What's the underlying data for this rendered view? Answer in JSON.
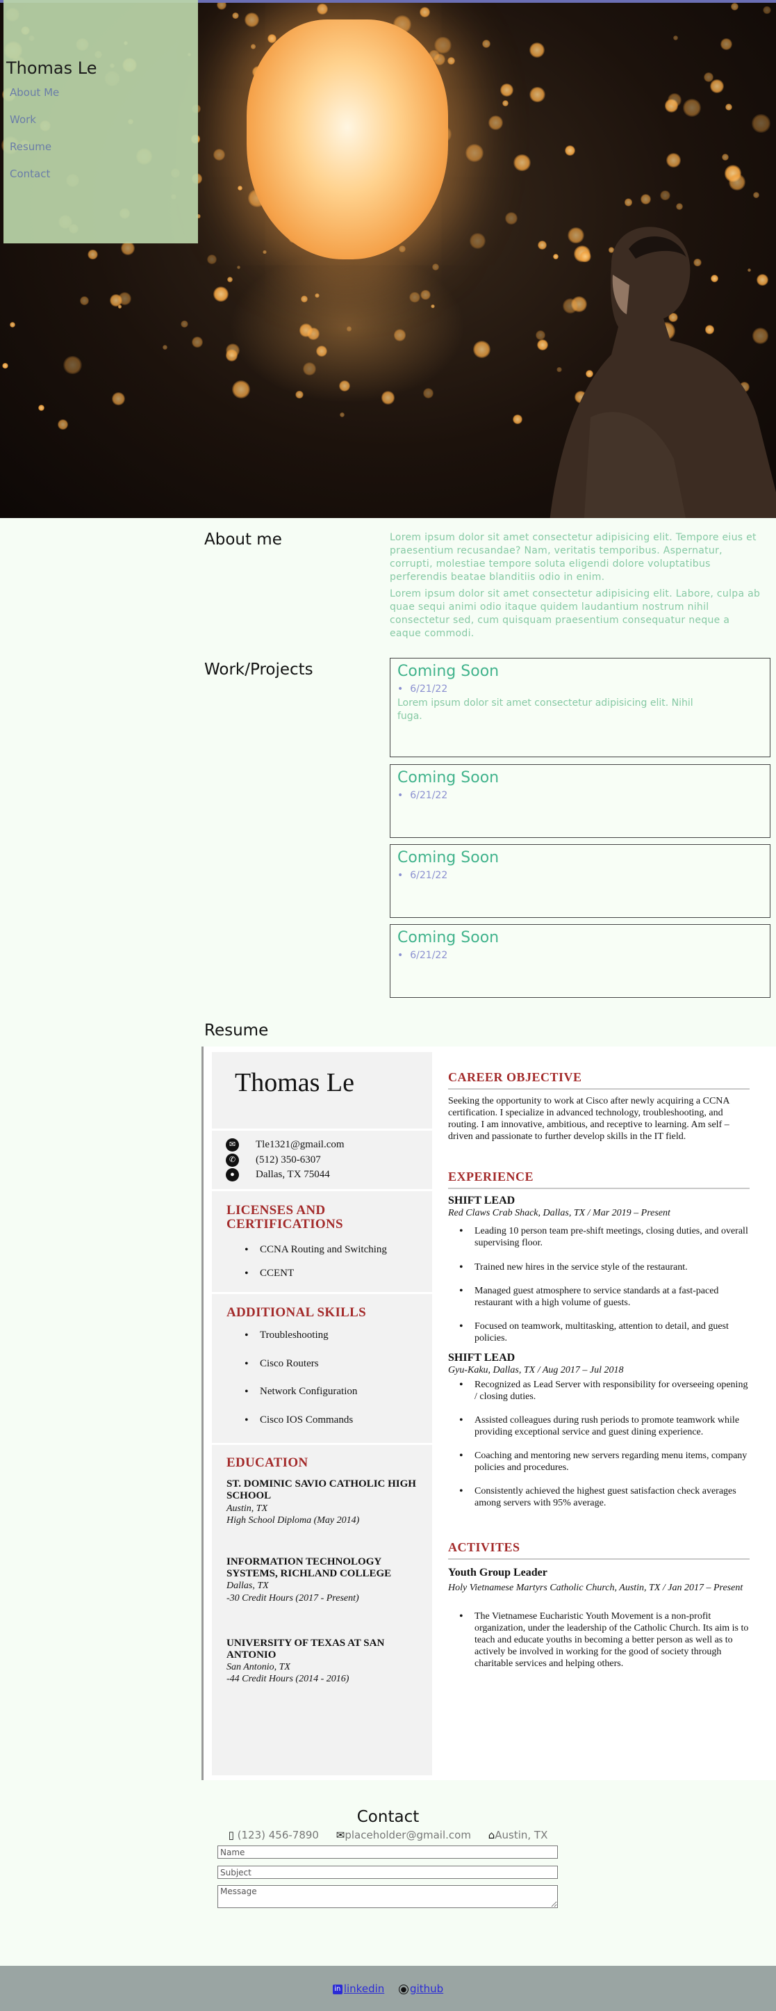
{
  "nav": {
    "brand": "Thomas Le",
    "links": [
      "About Me",
      "Work",
      "Resume",
      "Contact"
    ]
  },
  "about": {
    "title": "About me",
    "p1": "Lorem ipsum dolor sit amet consectetur adipisicing elit. Tempore eius et praesentium recusandae? Nam, veritatis temporibus. Aspernatur, corrupti, molestiae tempore soluta eligendi dolore voluptatibus perferendis beatae blanditiis odio in enim.",
    "p2": "Lorem ipsum dolor sit amet consectetur adipisicing elit. Labore, culpa ab quae sequi animi odio itaque quidem laudantium nostrum nihil consectetur sed, cum quisquam praesentium consequatur neque a eaque commodi."
  },
  "work": {
    "title": "Work/Projects",
    "cards": [
      {
        "title": "Coming Soon",
        "date": "6/21/22",
        "text": "Lorem ipsum dolor sit amet consectetur adipisicing elit. Nihil fuga."
      },
      {
        "title": "Coming Soon",
        "date": "6/21/22"
      },
      {
        "title": "Coming Soon",
        "date": "6/21/22"
      },
      {
        "title": "Coming Soon",
        "date": "6/21/22"
      }
    ]
  },
  "resume": {
    "title": "Resume",
    "name": "Thomas Le",
    "contact": {
      "email": "Tle1321@gmail.com",
      "phone": "(512) 350-6307",
      "location": "Dallas, TX 75044"
    },
    "licenses": {
      "heading_1": "LICENSES AND",
      "heading_2": "CERTIFICATIONS",
      "items": [
        "CCNA Routing and Switching",
        "CCENT"
      ]
    },
    "skills": {
      "heading": "ADDITIONAL SKILLS",
      "items": [
        "Troubleshooting",
        "Cisco Routers",
        "Network Configuration",
        "Cisco IOS Commands"
      ]
    },
    "education": {
      "heading": "EDUCATION",
      "schools": [
        {
          "name": "ST. DOMINIC SAVIO CATHOLIC HIGH SCHOOL",
          "location": "Austin, TX",
          "detail": "High School Diploma (May 2014)"
        },
        {
          "name": "INFORMATION TECHNOLOGY SYSTEMS, RICHLAND COLLEGE",
          "location": " Dallas, TX",
          "detail": "-30 Credit Hours (2017 - Present)"
        },
        {
          "name": "UNIVERSITY OF TEXAS AT SAN ANTONIO",
          "location": "San Antonio, TX",
          "detail": "-44 Credit Hours (2014 - 2016)"
        }
      ]
    },
    "objective": {
      "heading": "CAREER OBJECTIVE",
      "text": "Seeking the opportunity to work at Cisco after newly acquiring a CCNA certification. I specialize in advanced technology, troubleshooting, and routing. I am innovative, ambitious, and receptive to learning. Am self – driven and passionate  to further develop skills in the IT field."
    },
    "experience": {
      "heading": "EXPERIENCE",
      "jobs": [
        {
          "title": "SHIFT LEAD",
          "place": "Red Claws Crab Shack, Dallas, TX / Mar 2019 – Present",
          "bullets": [
            "Leading 10 person team pre-shift meetings, closing duties, and overall supervising floor.",
            "Trained new hires in the service style of the restaurant.",
            "Managed guest atmosphere to service standards at a fast-paced restaurant with a high volume of guests.",
            "Focused on teamwork, multitasking, attention to detail, and guest policies."
          ]
        },
        {
          "title": "SHIFT LEAD",
          "place": "Gyu-Kaku, Dallas, TX / Aug 2017 – Jul 2018",
          "bullets": [
            "Recognized as Lead Server with responsibility for overseeing opening / closing duties.",
            "Assisted colleagues during rush periods to promote teamwork while providing exceptional service and guest dining experience.",
            "Coaching and mentoring new servers regarding menu items, company policies and procedures.",
            "Consistently achieved the highest guest satisfaction check averages among servers with 95% average."
          ]
        }
      ]
    },
    "activities": {
      "heading": "ACTIVITES",
      "title": "Youth Group Leader",
      "place": "Holy Vietnamese Martyrs Catholic Church, Austin, TX / Jan 2017 – Present",
      "bullets": [
        "The Vietnamese Eucharistic Youth Movement is a non-profit organization, under the leadership of the Catholic Church. Its aim is to teach and educate youths in becoming a better person as well as to actively be involved in working for the good of society through charitable services and helping others."
      ]
    }
  },
  "contact": {
    "title": "Contact",
    "phone": "(123) 456-7890",
    "email": "placeholder@gmail.com",
    "location": "Austin, TX",
    "name_placeholder": "Name",
    "subject_placeholder": "Subject",
    "message_placeholder": "Message"
  },
  "footer": {
    "linkedin": "linkedin",
    "github": "github"
  }
}
